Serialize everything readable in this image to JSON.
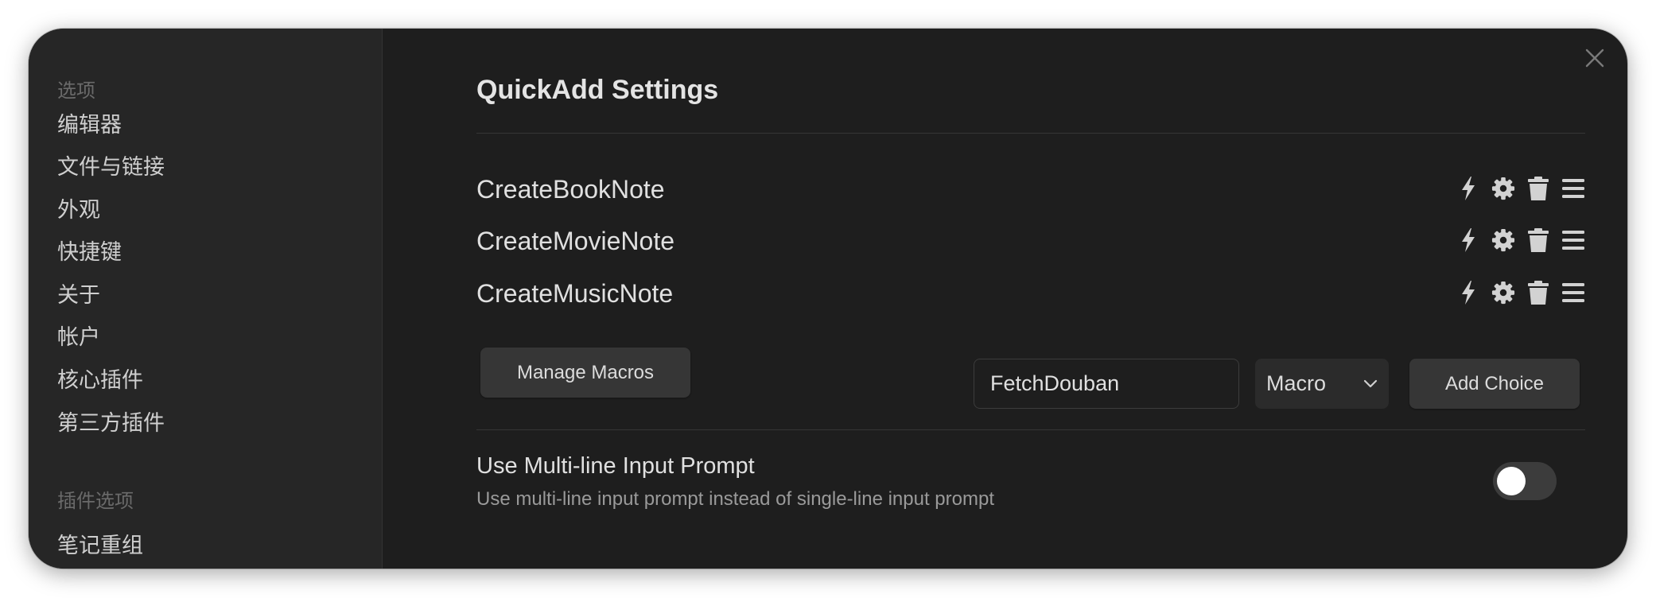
{
  "sidebar": {
    "options_heading": "选项",
    "items": [
      "编辑器",
      "文件与链接",
      "外观",
      "快捷键",
      "关于",
      "帐户",
      "核心插件",
      "第三方插件"
    ],
    "plugin_heading": "插件选项",
    "plugin_items": [
      "笔记重组"
    ]
  },
  "main": {
    "title": "QuickAdd Settings",
    "choices": [
      {
        "name": "CreateBookNote"
      },
      {
        "name": "CreateMovieNote"
      },
      {
        "name": "CreateMusicNote"
      }
    ],
    "manage_macros_label": "Manage Macros",
    "choice_input_value": "FetchDouban",
    "choice_type_selected": "Macro",
    "add_choice_label": "Add Choice",
    "multiline": {
      "name": "Use Multi-line Input Prompt",
      "description": "Use multi-line input prompt instead of single-line input prompt",
      "enabled": false
    }
  },
  "icons": {
    "close": "close-icon",
    "run": "lightning-icon",
    "configure": "gear-icon",
    "delete": "trash-icon",
    "drag": "drag-handle-icon",
    "select_caret": "chevron-down-icon"
  },
  "colors": {
    "window_bg": "#1e1e1e",
    "sidebar_bg": "#262626",
    "button_bg": "#363636",
    "text_primary": "#e0e0e0",
    "text_muted": "#9a9a9a",
    "toggle_off": "#3c3c3c"
  }
}
